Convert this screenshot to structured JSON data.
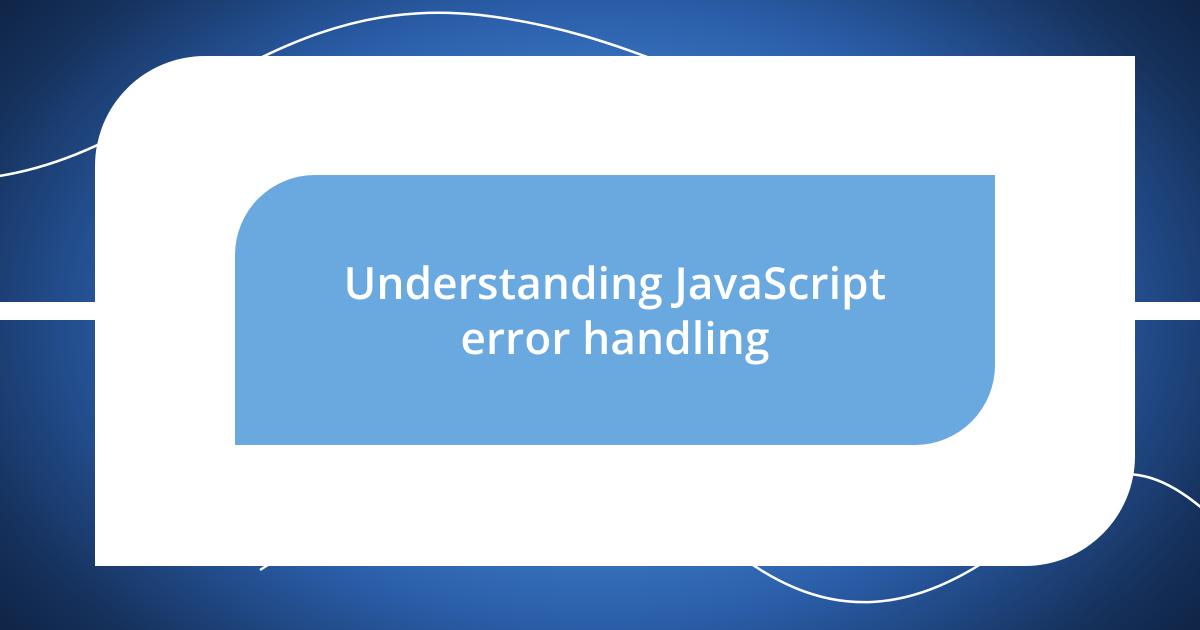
{
  "title": "Understanding JavaScript error handling",
  "colors": {
    "background_center": "#6aa8e8",
    "background_edge": "#0a1a35",
    "card_outer": "#ffffff",
    "card_inner": "#6aa8e0",
    "title_text": "#ffffff",
    "wave_stroke": "#ffffff"
  }
}
